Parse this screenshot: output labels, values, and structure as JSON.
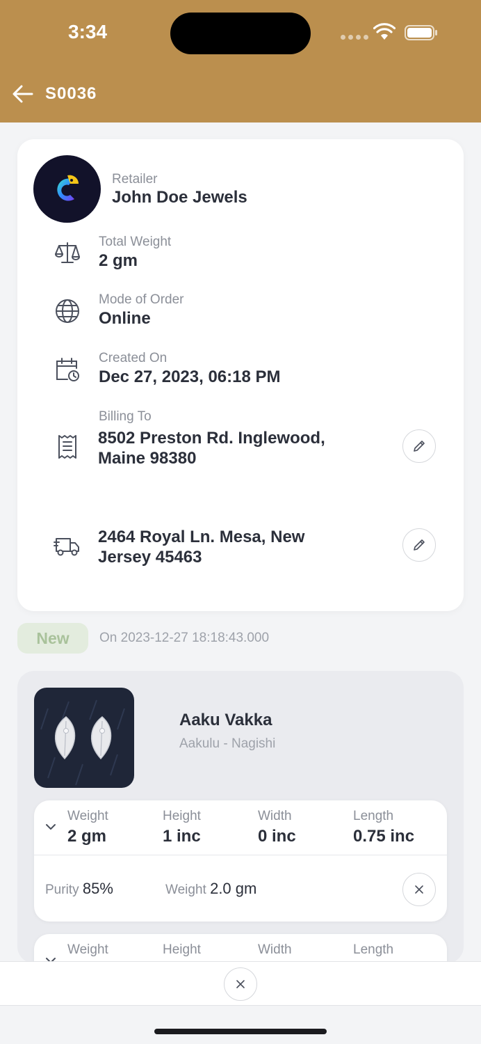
{
  "status_bar": {
    "time": "3:34"
  },
  "header": {
    "title": "S0036"
  },
  "order": {
    "retailer_label": "Retailer",
    "retailer_name": "John Doe Jewels",
    "total_weight_label": "Total Weight",
    "total_weight": "2 gm",
    "mode_label": "Mode of Order",
    "mode": "Online",
    "created_label": "Created On",
    "created": "Dec 27, 2023, 06:18 PM",
    "billing_label": "Billing To",
    "billing_line1": "8502 Preston Rd. Inglewood,",
    "billing_line2": "Maine 98380",
    "shipping_line1": "2464 Royal Ln. Mesa, New",
    "shipping_line2": "Jersey 45463"
  },
  "status": {
    "badge": "New",
    "date": "On 2023-12-27 18:18:43.000"
  },
  "product": {
    "name": "Aaku Vakka",
    "subtitle": "Aakulu - Nagishi",
    "variants": [
      {
        "weight_label": "Weight",
        "weight": "2 gm",
        "height_label": "Height",
        "height": "1 inc",
        "width_label": "Width",
        "width": "0 inc",
        "length_label": "Length",
        "length": "0.75 inc",
        "purity_label": "Purity",
        "purity": "85%",
        "detail_weight_label": "Weight",
        "detail_weight": "2.0 gm"
      },
      {
        "weight_label": "Weight",
        "height_label": "Height",
        "width_label": "Width",
        "length_label": "Length"
      }
    ]
  },
  "colors": {
    "header": "#bb8f4e",
    "badge_bg": "#e3ecde",
    "badge_text": "#a9c29b"
  }
}
